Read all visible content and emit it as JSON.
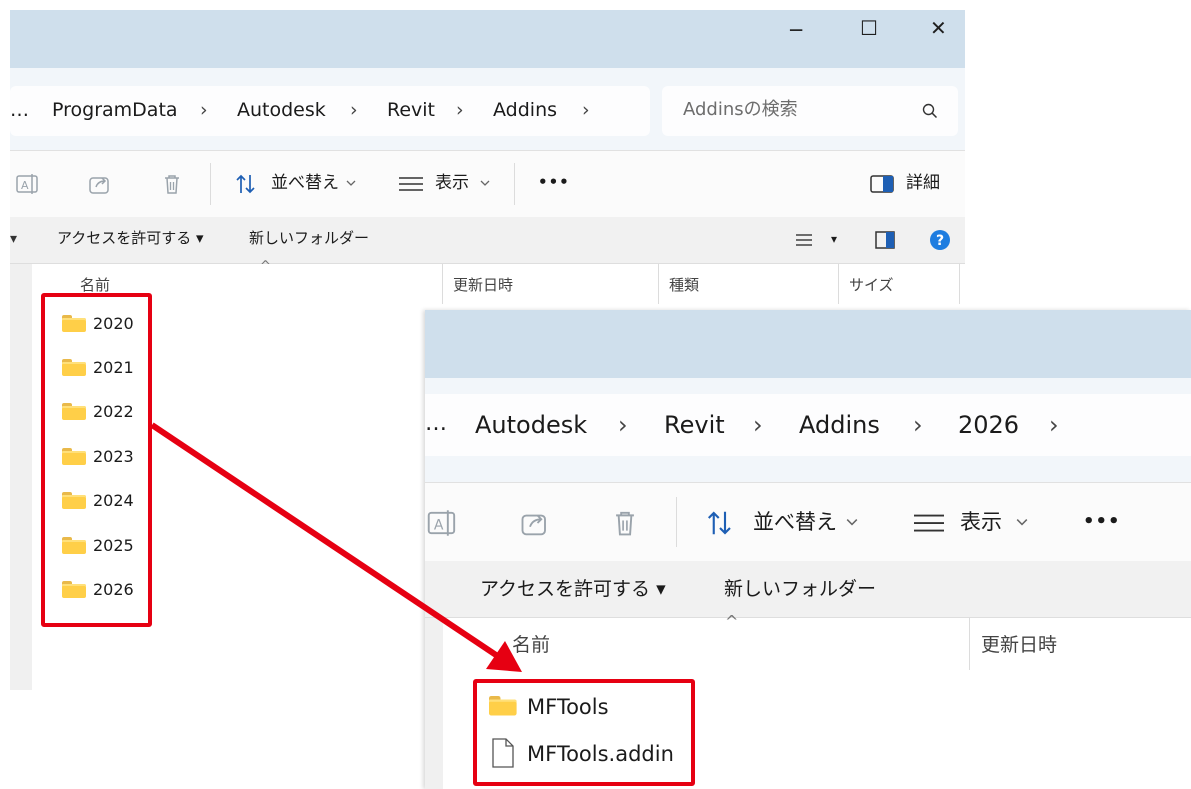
{
  "back": {
    "window_controls": {
      "minimize": "─",
      "maximize": "☐",
      "close": "✕"
    },
    "address": {
      "overflow": "…",
      "crumbs": [
        "ProgramData",
        "Autodesk",
        "Revit",
        "Addins"
      ],
      "separator": "›"
    },
    "search": {
      "placeholder": "Addinsの検索"
    },
    "toolbar": {
      "sort_label": "並べ替え",
      "view_label": "表示",
      "more": "•••",
      "details_label": "詳細"
    },
    "cmdbar": {
      "access_label": "アクセスを許可する ▾",
      "new_folder_label": "新しいフォルダー"
    },
    "columns": {
      "name": "名前",
      "date": "更新日時",
      "type": "種類",
      "size": "サイズ",
      "sort_indicator": "^"
    },
    "folders": [
      "2020",
      "2021",
      "2022",
      "2023",
      "2024",
      "2025",
      "2026"
    ]
  },
  "front": {
    "address": {
      "overflow": "…",
      "crumbs": [
        "Autodesk",
        "Revit",
        "Addins",
        "2026"
      ],
      "separator": "›"
    },
    "toolbar": {
      "sort_label": "並べ替え",
      "view_label": "表示",
      "more": "•••"
    },
    "cmdbar": {
      "access_label": "アクセスを許可する ▾",
      "new_folder_label": "新しいフォルダー"
    },
    "columns": {
      "name": "名前",
      "date": "更新日時",
      "sort_indicator": "^"
    },
    "items": [
      {
        "name": "MFTools",
        "kind": "folder"
      },
      {
        "name": "MFTools.addin",
        "kind": "file"
      }
    ]
  },
  "annotation": {
    "color": "#e60012"
  }
}
